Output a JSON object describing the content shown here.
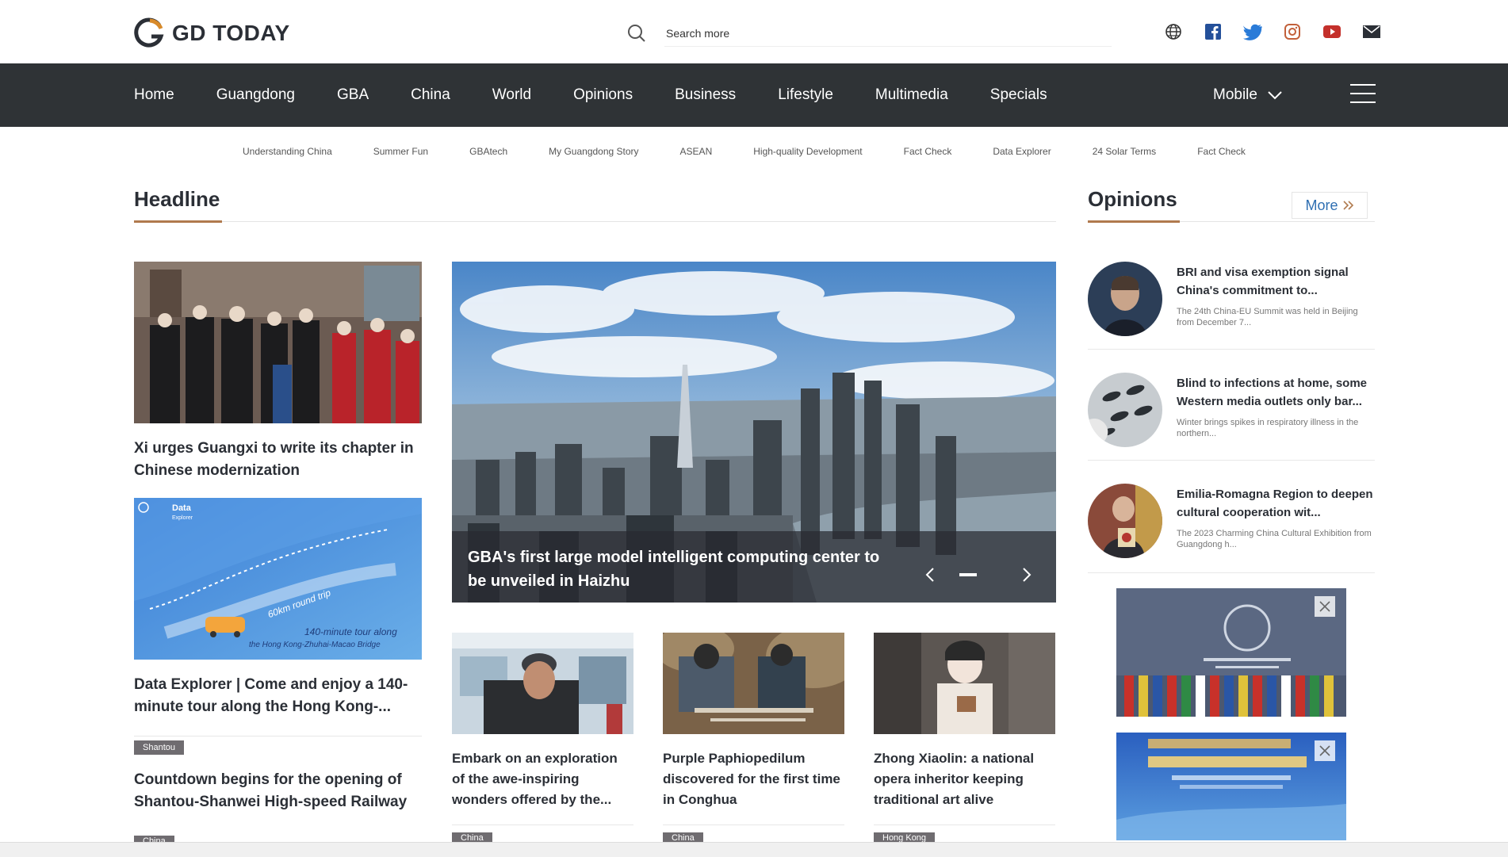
{
  "header": {
    "logo_text": "GD TODAY",
    "search_placeholder": "Search more",
    "social": [
      "globe-icon",
      "facebook-icon",
      "twitter-icon",
      "instagram-icon",
      "youtube-icon",
      "mail-icon"
    ]
  },
  "nav": {
    "items": [
      "Home",
      "Guangdong",
      "GBA",
      "China",
      "World",
      "Opinions",
      "Business",
      "Lifestyle",
      "Multimedia",
      "Specials"
    ],
    "mobile": "Mobile"
  },
  "subnav": [
    "Understanding China",
    "Summer Fun",
    "GBAtech",
    "My Guangdong Story",
    "ASEAN",
    "High-quality Development",
    "Fact Check",
    "Data Explorer",
    "24 Solar Terms",
    "Fact Check"
  ],
  "headline": {
    "title": "Headline",
    "left": [
      {
        "title": "Xi urges Guangxi to write its chapter in Chinese modernization"
      },
      {
        "title": "Data Explorer | Come and enjoy a 140-minute tour along the Hong Kong-..."
      },
      {
        "tag": "Shantou",
        "title": "Countdown begins for the opening of Shantou-Shanwei High-speed Railway"
      },
      {
        "tag": "China"
      }
    ],
    "slider": {
      "title": "GBA's first large model intelligent computing center to be unveiled in Haizhu"
    },
    "cards": [
      {
        "title": "Embark on an exploration of the awe-inspiring wonders offered by the...",
        "tag": "China"
      },
      {
        "title": "Purple Paphiopedilum discovered for the first time in Conghua",
        "tag": "China"
      },
      {
        "title": "Zhong Xiaolin: a national opera inheritor keeping traditional art alive",
        "tag": "Hong Kong"
      }
    ],
    "data_explorer_img": {
      "badge": "Data",
      "sub": "Explorer",
      "km": "60km round trip",
      "tour1": "140-minute tour along",
      "tour2": "the Hong Kong-Zhuhai-Macao Bridge"
    }
  },
  "opinions": {
    "title": "Opinions",
    "more": "More",
    "items": [
      {
        "title": "BRI and visa exemption signal China's commitment to...",
        "desc": "The 24th China-EU Summit was held in Beijing from December 7..."
      },
      {
        "title": "Blind to infections at home, some Western media outlets only bar...",
        "desc": "Winter brings spikes in respiratory illness in the northern..."
      },
      {
        "title": "Emilia-Romagna Region to deepen cultural cooperation wit...",
        "desc": "The 2023 Charming China Cultural Exhibition from Guangdong h..."
      }
    ]
  },
  "colors": {
    "nav_bg": "#2f3336",
    "accent": "#b07a4e",
    "link": "#2f6fb2",
    "tag_bg": "#6f6c70"
  }
}
